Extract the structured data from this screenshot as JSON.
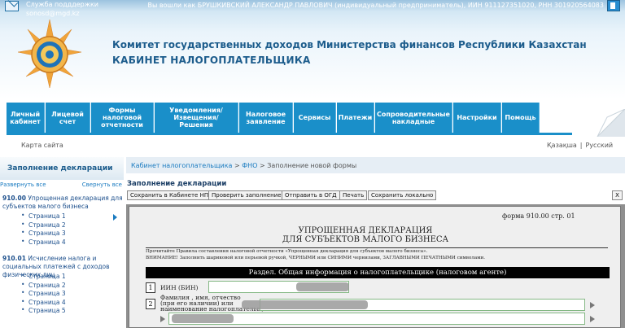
{
  "header": {
    "support_title": "Служба подддержки",
    "support_email": "sonosd@mgd.kz",
    "user_info": "Вы вошли как БРУШКИВСКИЙ АЛЕКСАНДР ПАВЛОВИЧ (индивидуальный предприниматель), ИИН 911127351020, РНН 301920564083",
    "org_name": "Комитет государственных доходов Министерства финансов Республики Казахстан",
    "cabinet_title": "КАБИНЕТ НАЛОГОПЛАТЕЛЬЩИКА"
  },
  "nav": {
    "items": [
      {
        "label": "Личный кабинет"
      },
      {
        "label": "Лицевой счет"
      },
      {
        "label": "Формы налоговой отчетности"
      },
      {
        "label": "Уведомления/ Извещения/ Решения"
      },
      {
        "label": "Налоговое заявление"
      },
      {
        "label": "Сервисы"
      },
      {
        "label": "Платежи"
      },
      {
        "label": "Сопроводительные накладные"
      },
      {
        "label": "Настройки"
      },
      {
        "label": "Помощь"
      }
    ]
  },
  "utility": {
    "sitemap": "Карта сайта",
    "lang_kz": "Қазақша",
    "lang_sep": "|",
    "lang_ru": "Русский"
  },
  "sidebar": {
    "title": "Заполнение декларации",
    "expand_all": "Развернуть все",
    "collapse_all": "Свернуть все",
    "declarations": [
      {
        "code": "910.00",
        "name": "Упрощенная декларация для субъектов малого бизнеса",
        "pages": [
          "Страница 1",
          "Страница 2",
          "Страница 3",
          "Страница 4"
        ]
      },
      {
        "code": "910.01",
        "name": "Исчисление налога и социальных платежей с доходов физических лиц",
        "pages": [
          "Страница 1",
          "Страница 2",
          "Страница 3",
          "Страница 4",
          "Страница 5"
        ]
      }
    ]
  },
  "main": {
    "breadcrumb": {
      "cabinet": "Кабинет налогоплательщика",
      "sep1": " > ",
      "fno": "ФНО",
      "sep2": " > ",
      "current": "Заполнение новой формы"
    },
    "title": "Заполнение декларации",
    "toolbar": {
      "save_cabinet": "Сохранить в Кабинете НП",
      "check": "Проверить заполнение",
      "send": "Отправить в ОГД",
      "print": "Печать",
      "save_local": "Сохранить локально",
      "close": "X"
    }
  },
  "form": {
    "form_label": "форма  910.00 стр.   01",
    "title_line1": "УПРОЩЕННАЯ ДЕКЛАРАЦИЯ",
    "title_line2": "ДЛЯ СУБЪЕКТОВ  МАЛОГО БИЗНЕСА",
    "note_line1": "Прочитайте Правила составления налоговой отчетности «Упрощенная декларация для субъектов малого бизнеса».",
    "note_line2": "ВНИМАНИЕ! Заполнить шариковой или перьевой ручкой, ЧЕРНЫМИ или СИНИМИ чернилами, ЗАГЛАВНЫМИ ПЕЧАТНЫМИ символами.",
    "section": "Раздел. Общая информация о налогоплательщике (налоговом агенте)",
    "fields": [
      {
        "num": "1",
        "label": "ИИН (БИН)"
      },
      {
        "num": "2",
        "label_line1": "Фамилия , имя, отчество",
        "label_line2": "(при его наличии) или",
        "label_line3": "наименование налогоплательщика"
      }
    ]
  },
  "colors": {
    "nav_bg": "#1a8fc9",
    "header_title": "#1c5c8c",
    "link": "#1a7bc0"
  }
}
